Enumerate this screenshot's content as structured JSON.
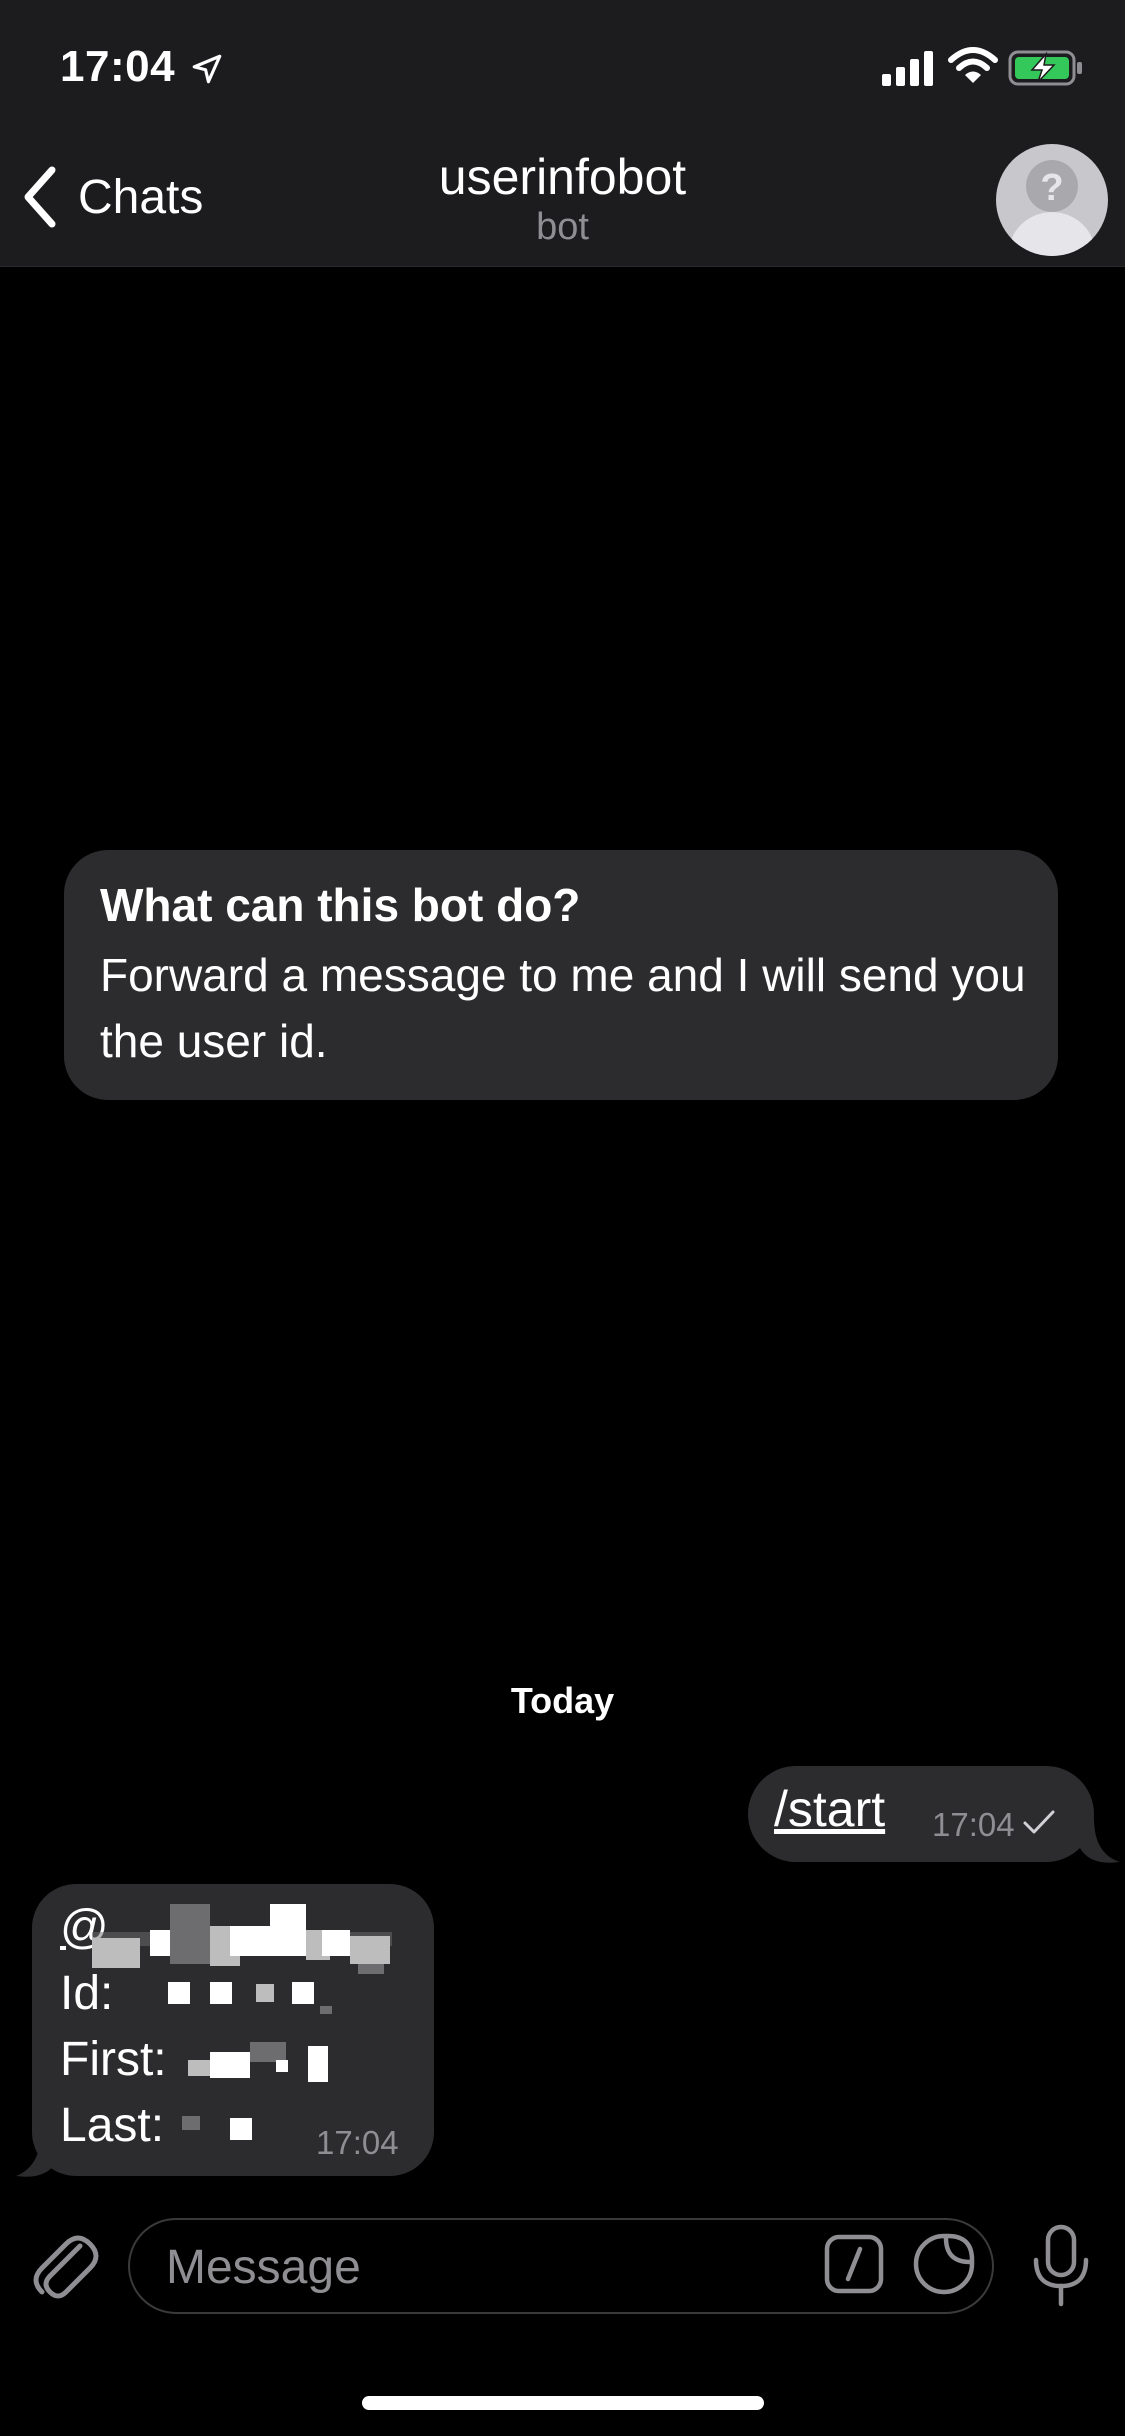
{
  "status_bar": {
    "time": "17:04",
    "icons": [
      "location-arrow-icon",
      "cellular-signal-icon",
      "wifi-icon",
      "battery-charging-icon"
    ],
    "battery_color": "#34c759"
  },
  "nav": {
    "back_label": "Chats",
    "title": "userinfobot",
    "subtitle": "bot",
    "avatar_icon": "question-mark-avatar-icon"
  },
  "bot_info": {
    "title": "What can this bot do?",
    "description": "Forward a message to me and I will send you the user id."
  },
  "date_separator": "Today",
  "messages": {
    "outgoing": {
      "text": "/start",
      "time": "17:04",
      "status_icon": "single-check-icon"
    },
    "incoming": {
      "line1": "@",
      "line2": "Id:",
      "line3": "First:",
      "line4": "Last:",
      "time": "17:04"
    }
  },
  "input": {
    "placeholder": "Message",
    "icons": [
      "paperclip-icon",
      "bot-commands-icon",
      "sticker-icon",
      "microphone-icon"
    ]
  },
  "colors": {
    "background": "#000000",
    "header": "#1c1c1e",
    "bubble": "#2c2c2e",
    "secondary_text": "#8e8e93"
  }
}
